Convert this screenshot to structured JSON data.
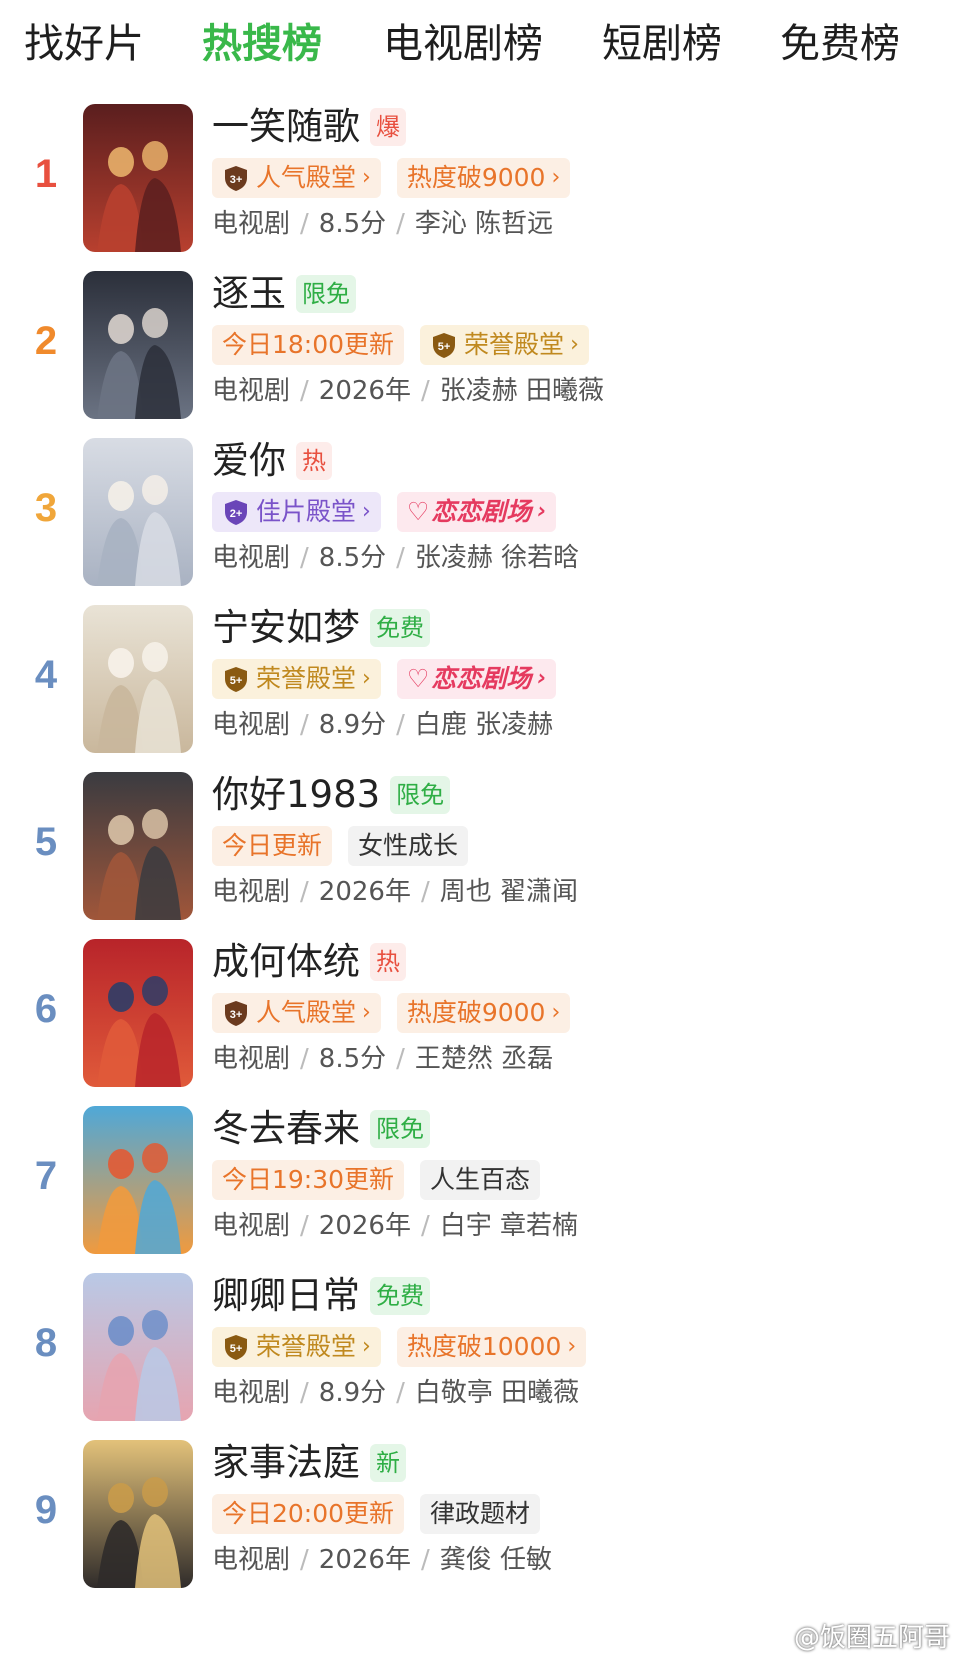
{
  "tabs": [
    {
      "label": "找好片",
      "active": false
    },
    {
      "label": "热搜榜",
      "active": true
    },
    {
      "label": "电视剧榜",
      "active": false
    },
    {
      "label": "短剧榜",
      "active": false
    },
    {
      "label": "免费榜",
      "active": false
    }
  ],
  "colors": {
    "accent_green": "#39b84a",
    "rank_red": "#e8503f",
    "rank_orange": "#f08a2c",
    "rank_gold": "#f0a63a",
    "rank_blue": "#6a8ec0"
  },
  "items": [
    {
      "rank": "1",
      "title": "一笑随歌",
      "badge": "爆",
      "badge_color": "red",
      "tags": [
        {
          "type": "orange",
          "icon": "shield-3-icon",
          "shield": "3+",
          "label": "人气殿堂"
        },
        {
          "type": "orange",
          "label": "热度破9000"
        }
      ],
      "category": "电视剧",
      "info": "8.5分",
      "cast": "李沁 陈哲远"
    },
    {
      "rank": "2",
      "title": "逐玉",
      "badge": "限免",
      "badge_color": "green",
      "tags": [
        {
          "type": "orange",
          "label": "今日18:00更新",
          "plain": true
        },
        {
          "type": "gold",
          "icon": "shield-5-icon",
          "shield": "5+",
          "label": "荣誉殿堂"
        }
      ],
      "category": "电视剧",
      "info": "2026年",
      "cast": "张凌赫 田曦薇"
    },
    {
      "rank": "3",
      "title": "爱你",
      "badge": "热",
      "badge_color": "red",
      "tags": [
        {
          "type": "purple",
          "icon": "shield-2-icon",
          "shield": "2+",
          "label": "佳片殿堂"
        },
        {
          "type": "pink",
          "label": "恋恋剧场"
        }
      ],
      "category": "电视剧",
      "info": "8.5分",
      "cast": "张凌赫 徐若晗"
    },
    {
      "rank": "4",
      "title": "宁安如梦",
      "badge": "免费",
      "badge_color": "green",
      "tags": [
        {
          "type": "gold",
          "icon": "shield-5-icon",
          "shield": "5+",
          "label": "荣誉殿堂"
        },
        {
          "type": "pink",
          "label": "恋恋剧场"
        }
      ],
      "category": "电视剧",
      "info": "8.9分",
      "cast": "白鹿 张凌赫"
    },
    {
      "rank": "5",
      "title": "你好1983",
      "badge": "限免",
      "badge_color": "green",
      "tags": [
        {
          "type": "orange",
          "label": "今日更新",
          "plain": true
        },
        {
          "type": "gray",
          "label": "女性成长",
          "plain": true
        }
      ],
      "category": "电视剧",
      "info": "2026年",
      "cast": "周也 翟潇闻"
    },
    {
      "rank": "6",
      "title": "成何体统",
      "badge": "热",
      "badge_color": "red",
      "tags": [
        {
          "type": "orange",
          "icon": "shield-3-icon",
          "shield": "3+",
          "label": "人气殿堂"
        },
        {
          "type": "orange",
          "label": "热度破9000"
        }
      ],
      "category": "电视剧",
      "info": "8.5分",
      "cast": "王楚然 丞磊"
    },
    {
      "rank": "7",
      "title": "冬去春来",
      "badge": "限免",
      "badge_color": "green",
      "tags": [
        {
          "type": "orange",
          "label": "今日19:30更新",
          "plain": true
        },
        {
          "type": "gray",
          "label": "人生百态",
          "plain": true
        }
      ],
      "category": "电视剧",
      "info": "2026年",
      "cast": "白宇 章若楠"
    },
    {
      "rank": "8",
      "title": "卿卿日常",
      "badge": "免费",
      "badge_color": "green",
      "tags": [
        {
          "type": "gold",
          "icon": "shield-5-icon",
          "shield": "5+",
          "label": "荣誉殿堂"
        },
        {
          "type": "orange",
          "label": "热度破10000"
        }
      ],
      "category": "电视剧",
      "info": "8.9分",
      "cast": "白敬亭 田曦薇"
    },
    {
      "rank": "9",
      "title": "家事法庭",
      "badge": "新",
      "badge_color": "green",
      "tags": [
        {
          "type": "orange",
          "label": "今日20:00更新",
          "plain": true
        },
        {
          "type": "gray",
          "label": "律政题材",
          "plain": true
        }
      ],
      "category": "电视剧",
      "info": "2026年",
      "cast": "龚俊 任敏"
    }
  ],
  "watermark": "@饭圈五阿哥"
}
